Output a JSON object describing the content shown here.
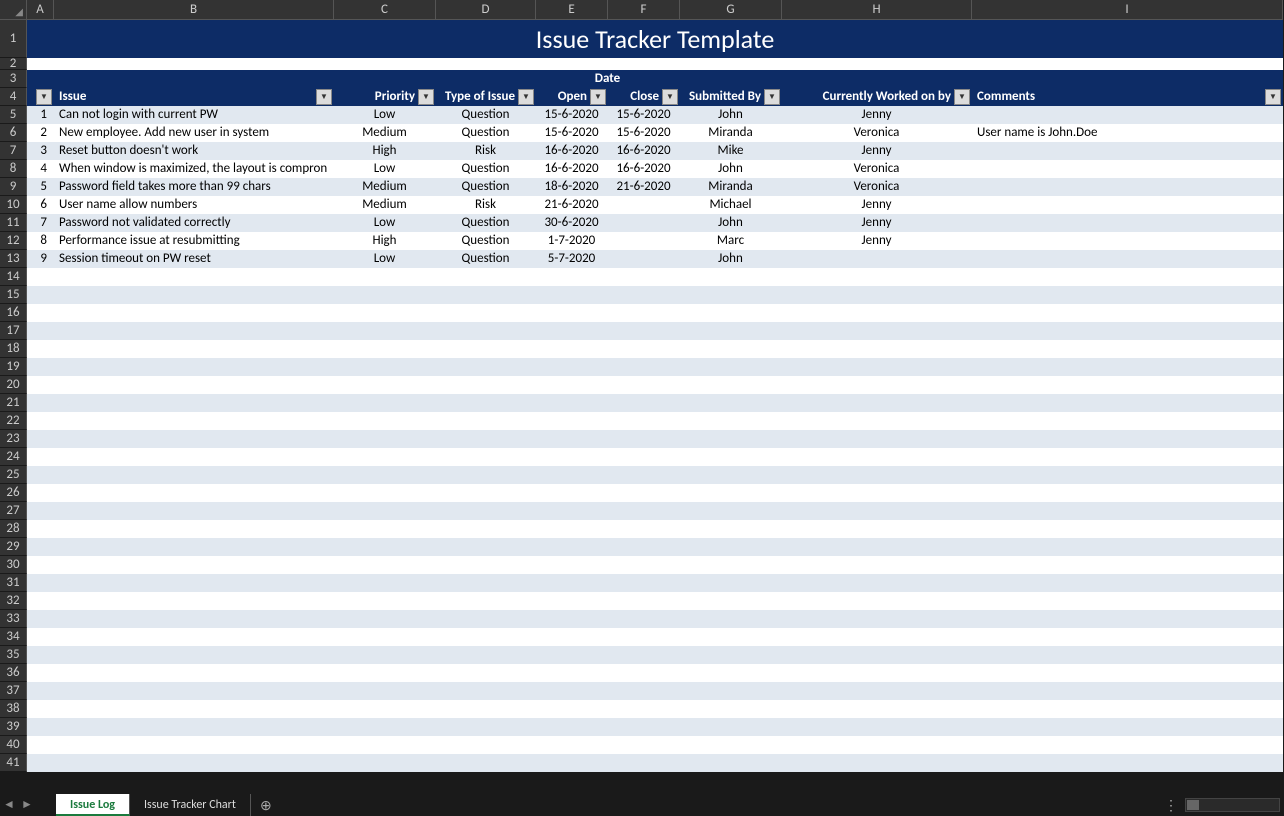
{
  "title": "Issue Tracker Template",
  "columns": {
    "letters": [
      "A",
      "B",
      "C",
      "D",
      "E",
      "F",
      "G",
      "H",
      "I"
    ],
    "widths": [
      27,
      280,
      102,
      100,
      72,
      72,
      102,
      190,
      311
    ]
  },
  "headers": {
    "date": "Date",
    "issue": "Issue",
    "priority": "Priority",
    "type": "Type of Issue",
    "open": "Open",
    "close": "Close",
    "submitted": "Submitted By",
    "worked": "Currently Worked on by",
    "comments": "Comments"
  },
  "rows": [
    {
      "n": 1,
      "issue": "Can not login with current PW",
      "priority": "Low",
      "type": "Question",
      "open": "15-6-2020",
      "close": "15-6-2020",
      "submitted": "John",
      "worked": "Jenny",
      "comments": ""
    },
    {
      "n": 2,
      "issue": "New employee. Add new user in system",
      "priority": "Medium",
      "type": "Question",
      "open": "15-6-2020",
      "close": "15-6-2020",
      "submitted": "Miranda",
      "worked": "Veronica",
      "comments": "User name is John.Doe"
    },
    {
      "n": 3,
      "issue": "Reset button doesn't work",
      "priority": "High",
      "type": "Risk",
      "open": "16-6-2020",
      "close": "16-6-2020",
      "submitted": "Mike",
      "worked": "Jenny",
      "comments": ""
    },
    {
      "n": 4,
      "issue": "When window is maximized, the layout is compron",
      "priority": "Low",
      "type": "Question",
      "open": "16-6-2020",
      "close": "16-6-2020",
      "submitted": "John",
      "worked": "Veronica",
      "comments": ""
    },
    {
      "n": 5,
      "issue": "Password field takes more than 99 chars",
      "priority": "Medium",
      "type": "Question",
      "open": "18-6-2020",
      "close": "21-6-2020",
      "submitted": "Miranda",
      "worked": "Veronica",
      "comments": ""
    },
    {
      "n": 6,
      "issue": "User name allow numbers",
      "priority": "Medium",
      "type": "Risk",
      "open": "21-6-2020",
      "close": "",
      "submitted": "Michael",
      "worked": "Jenny",
      "comments": ""
    },
    {
      "n": 7,
      "issue": "Password not validated correctly",
      "priority": "Low",
      "type": "Question",
      "open": "30-6-2020",
      "close": "",
      "submitted": "John",
      "worked": "Jenny",
      "comments": ""
    },
    {
      "n": 8,
      "issue": "Performance issue at resubmitting",
      "priority": "High",
      "type": "Question",
      "open": "1-7-2020",
      "close": "",
      "submitted": "Marc",
      "worked": "Jenny",
      "comments": ""
    },
    {
      "n": 9,
      "issue": "Session timeout on PW reset",
      "priority": "Low",
      "type": "Question",
      "open": "5-7-2020",
      "close": "",
      "submitted": "John",
      "worked": "",
      "comments": ""
    }
  ],
  "emptyRowNumbers": [
    14,
    15,
    16,
    17,
    18,
    19,
    20,
    21,
    22,
    23,
    24,
    25,
    26,
    27,
    28,
    29,
    30,
    31,
    32,
    33,
    34,
    35,
    36,
    37,
    38,
    39,
    40,
    41
  ],
  "tabs": {
    "active": "Issue Log",
    "other": "Issue Tracker Chart"
  }
}
